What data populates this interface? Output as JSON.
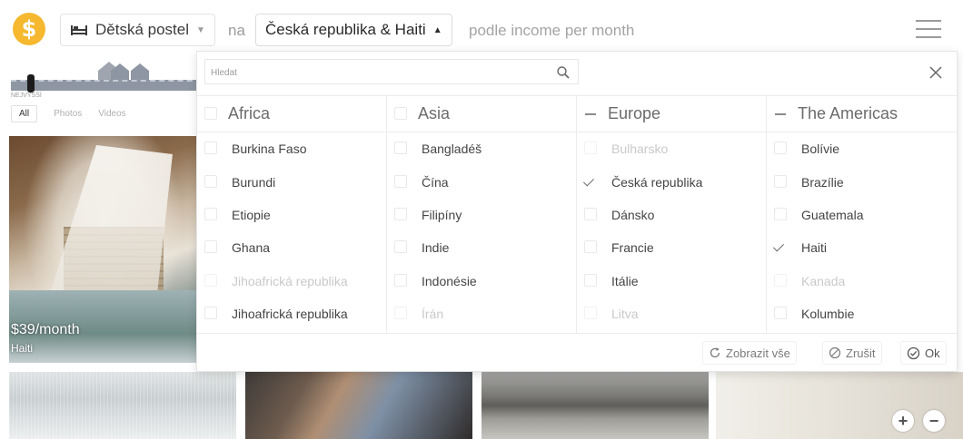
{
  "header": {
    "logo_symbol": "$",
    "thing_label": "Dětská postel",
    "na_label": "na",
    "country_label": "Česká republika & Haiti",
    "podle_label": "podle income per month"
  },
  "income_strip": {
    "scale_label": "NEJVYŠŠÍ"
  },
  "media_tabs": [
    "All",
    "Photos",
    "Videos"
  ],
  "photo_left": {
    "income": "$39/month",
    "country": "Haiti"
  },
  "dropdown": {
    "search_placeholder": "Hledat",
    "columns": [
      {
        "title": "Africa",
        "partial": false,
        "items": [
          {
            "label": "Burkina Faso",
            "checked": false,
            "disabled": false
          },
          {
            "label": "Burundi",
            "checked": false,
            "disabled": false
          },
          {
            "label": "Etiopie",
            "checked": false,
            "disabled": false
          },
          {
            "label": "Ghana",
            "checked": false,
            "disabled": false
          },
          {
            "label": "Jihoafrická republika",
            "checked": false,
            "disabled": true
          },
          {
            "label": "Jihoafrická republika",
            "checked": false,
            "disabled": false
          }
        ]
      },
      {
        "title": "Asia",
        "partial": false,
        "items": [
          {
            "label": "Bangladéš",
            "checked": false,
            "disabled": false
          },
          {
            "label": "Čína",
            "checked": false,
            "disabled": false
          },
          {
            "label": "Filipíny",
            "checked": false,
            "disabled": false
          },
          {
            "label": "Indie",
            "checked": false,
            "disabled": false
          },
          {
            "label": "Indonésie",
            "checked": false,
            "disabled": false
          },
          {
            "label": "Írán",
            "checked": false,
            "disabled": true
          }
        ]
      },
      {
        "title": "Europe",
        "partial": true,
        "items": [
          {
            "label": "Bulharsko",
            "checked": false,
            "disabled": true
          },
          {
            "label": "Česká republika",
            "checked": true,
            "disabled": false
          },
          {
            "label": "Dánsko",
            "checked": false,
            "disabled": false
          },
          {
            "label": "Francie",
            "checked": false,
            "disabled": false
          },
          {
            "label": "Itálie",
            "checked": false,
            "disabled": false
          },
          {
            "label": "Litva",
            "checked": false,
            "disabled": true
          }
        ]
      },
      {
        "title": "The Americas",
        "partial": true,
        "items": [
          {
            "label": "Bolívie",
            "checked": false,
            "disabled": false
          },
          {
            "label": "Brazílie",
            "checked": false,
            "disabled": false
          },
          {
            "label": "Guatemala",
            "checked": false,
            "disabled": false
          },
          {
            "label": "Haiti",
            "checked": true,
            "disabled": false
          },
          {
            "label": "Kanada",
            "checked": false,
            "disabled": true
          },
          {
            "label": "Kolumbie",
            "checked": false,
            "disabled": false
          }
        ]
      }
    ],
    "footer": {
      "show_all_label": "Zobrazit vše",
      "cancel_label": "Zrušit",
      "ok_label": "Ok"
    }
  },
  "zoom": {
    "plus": "+",
    "minus": "−"
  },
  "colors": {
    "logo": "#f5b82e",
    "text": "#4a4a4a",
    "disabled": "#c9c9c9"
  }
}
